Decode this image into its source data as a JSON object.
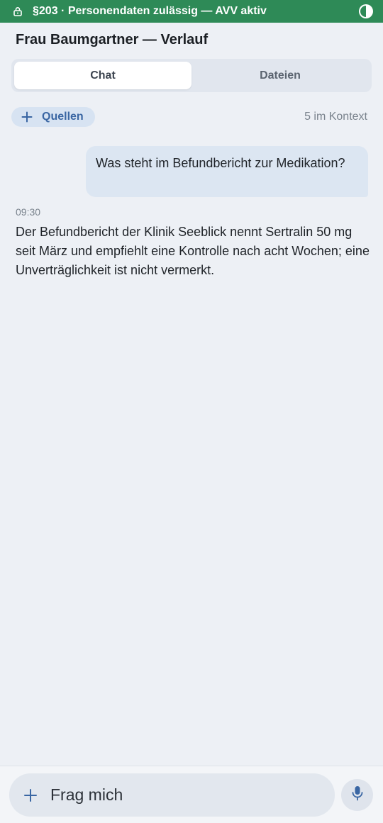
{
  "status": {
    "text": "§203 · Personendaten zulässig — AVV aktiv",
    "bg_color": "#2e8a57",
    "lock_icon": "lock-icon",
    "contrast_icon": "contrast-icon"
  },
  "header": {
    "title": "Frau Baumgartner — Verlauf"
  },
  "tabs": [
    {
      "label": "Chat",
      "active": true
    },
    {
      "label": "Dateien",
      "active": false
    }
  ],
  "sources": {
    "label": "Quellen",
    "context_count": "5 im Kontext"
  },
  "conversation": {
    "user_message": "Was steht im Befundbericht zur Medikation?",
    "reply_time": "09:30",
    "assistant_reply": "Der Befundbericht der Klinik Seeblick nennt Sertralin 50 mg seit März und empfiehlt eine Kontrolle nach acht Wochen; eine Unverträglichkeit ist nicht vermerkt."
  },
  "composer": {
    "placeholder": "Frag mich",
    "mic_icon": "mic-icon"
  },
  "colors": {
    "accent": "#3a66a3",
    "background": "#edf0f5",
    "user_bubble": "#dce6f2"
  }
}
